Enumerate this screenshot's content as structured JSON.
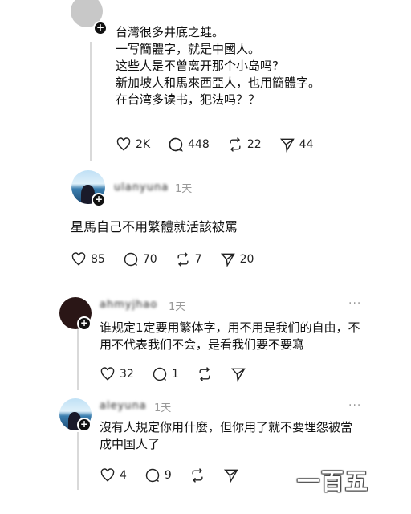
{
  "post1": {
    "lines": [
      "台灣很多井底之蛙。",
      "一写簡體字，就是中國人。",
      "这些人是不曾离开那个小岛吗?",
      "新加坡人和馬來西亞人，也用簡體字。",
      "在台湾多读书，犯法吗？？"
    ],
    "likes": "2K",
    "comments": "448",
    "reposts": "22",
    "shares": "44"
  },
  "post2": {
    "time": "1天",
    "text": "星馬自己不用繁體就活該被罵",
    "likes": "85",
    "comments": "70",
    "reposts": "7",
    "shares": "20"
  },
  "post3": {
    "time": "1天",
    "more": "···",
    "lines": [
      "谁规定1定要用繁体字，用不用是我们的自由，不",
      "用不代表我们不会，是看我们要不要寫"
    ],
    "likes": "32",
    "comments": "1"
  },
  "post4": {
    "time": "1天",
    "more": "···",
    "lines": [
      "沒有人規定你用什麼，但你用了就不要埋怨被當",
      "成中国人了"
    ],
    "likes": "4",
    "comments": "9"
  },
  "watermark": "一百五"
}
